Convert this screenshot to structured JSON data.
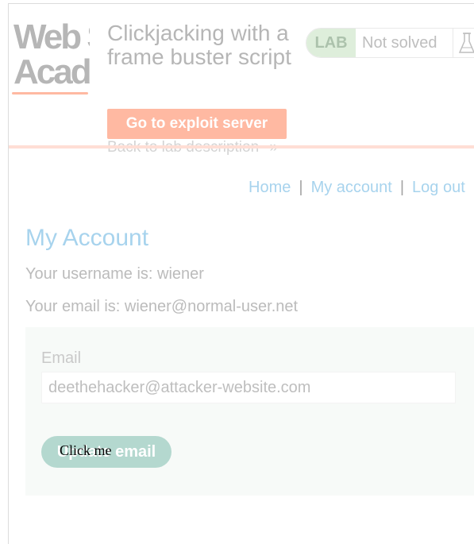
{
  "decoy": {
    "label": "Click me"
  },
  "frame": {
    "logo": {
      "line1": "Web Security",
      "line2": "Academy"
    },
    "lab": {
      "title": "Clickjacking with a frame buster script",
      "tag": "LAB",
      "status": "Not solved",
      "flask_icon": "flask-icon"
    },
    "exploit_button": "Go to exploit server",
    "back_link": "Back to lab description",
    "back_chevron": "»",
    "nav": {
      "home": "Home",
      "separator": "|",
      "my_account": "My account",
      "log_out": "Log out"
    },
    "account": {
      "title": "My Account",
      "username_line": "Your username is: wiener",
      "email_line": "Your email is: wiener@normal-user.net"
    },
    "form": {
      "email_label": "Email",
      "email_value": "deethehacker@attacker-website.com",
      "submit_label": "Update email"
    }
  },
  "colors": {
    "accent_orange": "#ff6633",
    "link_blue": "#3d9ed9",
    "button_teal": "#5aaa96",
    "lab_green": "#b8dbb0"
  }
}
